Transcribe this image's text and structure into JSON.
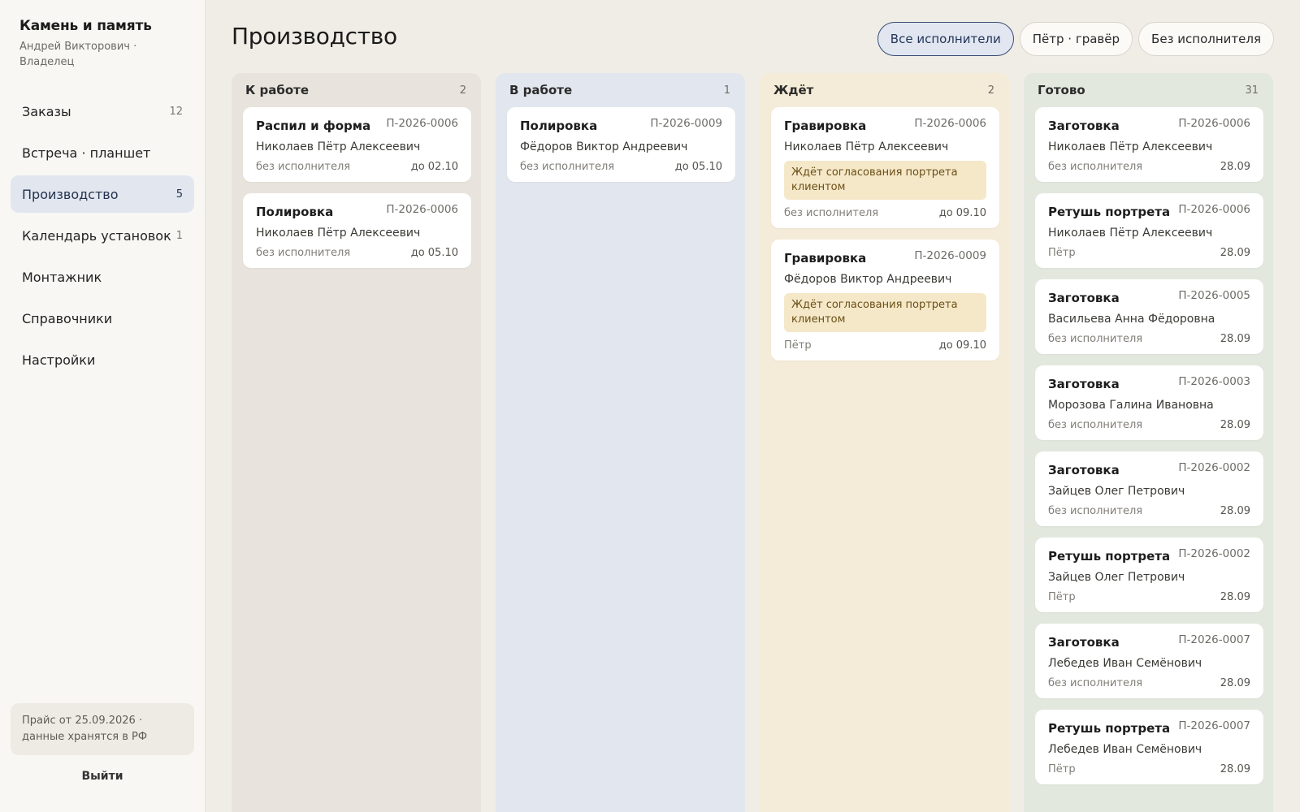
{
  "sidebar": {
    "brand_title": "Камень и память",
    "brand_sub": "Андрей Викторович · Владелец",
    "nav": [
      {
        "label": "Заказы",
        "count": "12",
        "active": false
      },
      {
        "label": "Встреча · планшет",
        "count": "",
        "active": false
      },
      {
        "label": "Производство",
        "count": "5",
        "active": true
      },
      {
        "label": "Календарь установок",
        "count": "1",
        "active": false
      },
      {
        "label": "Монтажник",
        "count": "",
        "active": false
      },
      {
        "label": "Справочники",
        "count": "",
        "active": false
      },
      {
        "label": "Настройки",
        "count": "",
        "active": false
      }
    ],
    "price_note": "Прайс от 25.09.2026 · данные хранятся в РФ",
    "logout": "Выйти"
  },
  "main": {
    "title": "Производство",
    "filters": [
      {
        "label": "Все исполнители",
        "active": true
      },
      {
        "label": "Пётр · гравёр",
        "active": false
      },
      {
        "label": "Без исполнителя",
        "active": false
      }
    ],
    "columns": [
      {
        "key": "todo",
        "name": "К работе",
        "count": "2",
        "cards": [
          {
            "title": "Распил и форма",
            "id": "П-2026-0006",
            "client": "Николаев Пётр Алексеевич",
            "note": "",
            "assignee": "без исполнителя",
            "due": "до 02.10"
          },
          {
            "title": "Полировка",
            "id": "П-2026-0006",
            "client": "Николаев Пётр Алексеевич",
            "note": "",
            "assignee": "без исполнителя",
            "due": "до 05.10"
          }
        ]
      },
      {
        "key": "progress",
        "name": "В работе",
        "count": "1",
        "cards": [
          {
            "title": "Полировка",
            "id": "П-2026-0009",
            "client": "Фёдоров Виктор Андреевич",
            "note": "",
            "assignee": "без исполнителя",
            "due": "до 05.10"
          }
        ]
      },
      {
        "key": "wait",
        "name": "Ждёт",
        "count": "2",
        "cards": [
          {
            "title": "Гравировка",
            "id": "П-2026-0006",
            "client": "Николаев Пётр Алексеевич",
            "note": "Ждёт согласования портрета клиентом",
            "assignee": "без исполнителя",
            "due": "до 09.10"
          },
          {
            "title": "Гравировка",
            "id": "П-2026-0009",
            "client": "Фёдоров Виктор Андреевич",
            "note": "Ждёт согласования портрета клиентом",
            "assignee": "Пётр",
            "due": "до 09.10"
          }
        ]
      },
      {
        "key": "done",
        "name": "Готово",
        "count": "31",
        "cards": [
          {
            "title": "Заготовка",
            "id": "П-2026-0006",
            "client": "Николаев Пётр Алексеевич",
            "note": "",
            "assignee": "без исполнителя",
            "due": "28.09"
          },
          {
            "title": "Ретушь портрета",
            "id": "П-2026-0006",
            "client": "Николаев Пётр Алексеевич",
            "note": "",
            "assignee": "Пётр",
            "due": "28.09"
          },
          {
            "title": "Заготовка",
            "id": "П-2026-0005",
            "client": "Васильева Анна Фёдоровна",
            "note": "",
            "assignee": "без исполнителя",
            "due": "28.09"
          },
          {
            "title": "Заготовка",
            "id": "П-2026-0003",
            "client": "Морозова Галина Ивановна",
            "note": "",
            "assignee": "без исполнителя",
            "due": "28.09"
          },
          {
            "title": "Заготовка",
            "id": "П-2026-0002",
            "client": "Зайцев Олег Петрович",
            "note": "",
            "assignee": "без исполнителя",
            "due": "28.09"
          },
          {
            "title": "Ретушь портрета",
            "id": "П-2026-0002",
            "client": "Зайцев Олег Петрович",
            "note": "",
            "assignee": "Пётр",
            "due": "28.09"
          },
          {
            "title": "Заготовка",
            "id": "П-2026-0007",
            "client": "Лебедев Иван Семёнович",
            "note": "",
            "assignee": "без исполнителя",
            "due": "28.09"
          },
          {
            "title": "Ретушь портрета",
            "id": "П-2026-0007",
            "client": "Лебедев Иван Семёнович",
            "note": "",
            "assignee": "Пётр",
            "due": "28.09"
          }
        ]
      }
    ]
  }
}
